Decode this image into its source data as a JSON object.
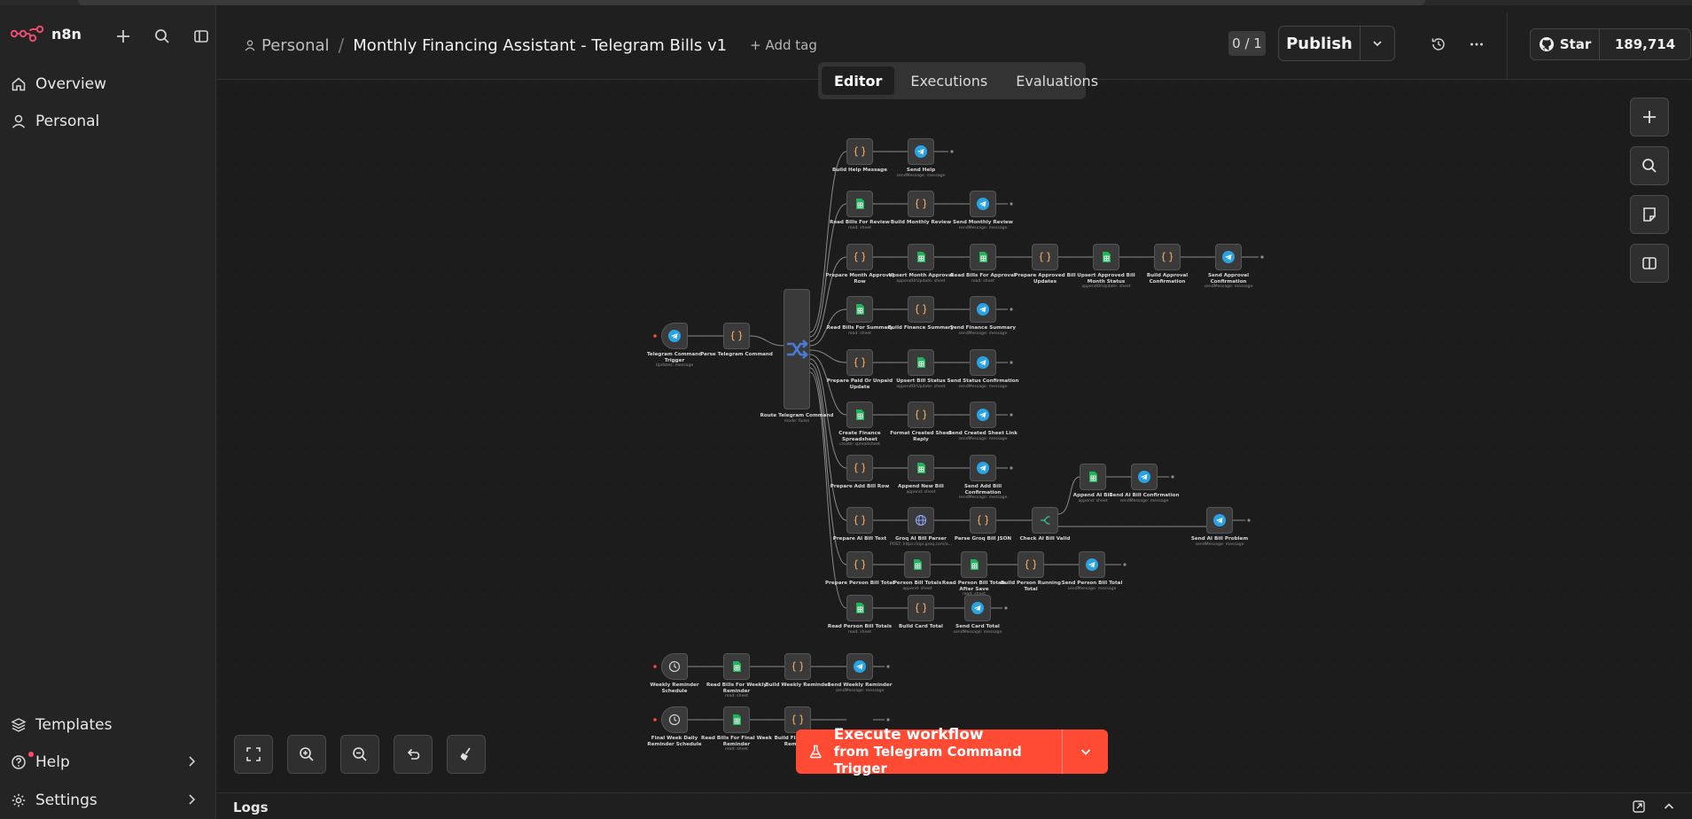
{
  "app": {
    "logo_text": "n8n"
  },
  "sidebar": {
    "top_items": [
      {
        "label": "Overview",
        "icon": "home-icon"
      },
      {
        "label": "Personal",
        "icon": "user-icon"
      }
    ],
    "bottom_items": [
      {
        "label": "Templates",
        "icon": "box-icon"
      },
      {
        "label": "Help",
        "icon": "help-icon"
      },
      {
        "label": "Settings",
        "icon": "gear-icon"
      }
    ]
  },
  "header": {
    "project": "Personal",
    "workflow_title": "Monthly Financing Assistant - Telegram Bills v1",
    "add_tag": "+ Add tag",
    "counter": "0 / 1",
    "publish": "Publish",
    "github_star": "Star",
    "github_count": "189,714"
  },
  "tabs": [
    {
      "label": "Editor",
      "active": true
    },
    {
      "label": "Executions",
      "active": false
    },
    {
      "label": "Evaluations",
      "active": false
    }
  ],
  "execute": {
    "title": "Execute workflow",
    "subtitle": "from Telegram Command Trigger"
  },
  "logs": {
    "label": "Logs"
  },
  "colors": {
    "accent": "#ff4a34",
    "telegram": "#2aa3e3",
    "sheets": "#22b35a",
    "code": "#e8a15b",
    "route": "#4b7bd8"
  },
  "nodes": {
    "trigger": {
      "label": "Telegram Command Trigger",
      "sub": "Updates: message"
    },
    "parse": {
      "label": "Parse Telegram Command",
      "sub": ""
    },
    "route": {
      "label": "Route Telegram Command",
      "sub": "mode: Rules"
    },
    "weekly_trigger": {
      "label": "Weekly Reminder Schedule",
      "sub": ""
    },
    "final_trigger": {
      "label": "Final Week Daily Reminder Schedule",
      "sub": ""
    },
    "rows": [
      [
        {
          "label": "Build Help Message",
          "sub": ""
        },
        {
          "label": "Send Help",
          "sub": "sendMessage: message"
        }
      ],
      [
        {
          "label": "Read Bills For Review",
          "sub": "read: sheet"
        },
        {
          "label": "Build Monthly Review",
          "sub": ""
        },
        {
          "label": "Send Monthly Review",
          "sub": "sendMessage: message"
        }
      ],
      [
        {
          "label": "Prepare Month Approval Row",
          "sub": ""
        },
        {
          "label": "Upsert Month Approval",
          "sub": "appendOrUpdate: sheet"
        },
        {
          "label": "Read Bills For Approval",
          "sub": "read: sheet"
        },
        {
          "label": "Prepare Approved Bill Updates",
          "sub": ""
        },
        {
          "label": "Upsert Approved Bill Month Status",
          "sub": "appendOrUpdate: sheet"
        },
        {
          "label": "Build Approval Confirmation",
          "sub": ""
        },
        {
          "label": "Send Approval Confirmation",
          "sub": "sendMessage: message"
        }
      ],
      [
        {
          "label": "Read Bills For Summary",
          "sub": "read: sheet"
        },
        {
          "label": "Build Finance Summary",
          "sub": ""
        },
        {
          "label": "Send Finance Summary",
          "sub": "sendMessage: message"
        }
      ],
      [
        {
          "label": "Prepare Paid Or Unpaid Update",
          "sub": ""
        },
        {
          "label": "Upsert Bill Status",
          "sub": "appendOrUpdate: sheet"
        },
        {
          "label": "Send Status Confirmation",
          "sub": "sendMessage: message"
        }
      ],
      [
        {
          "label": "Create Finance Spreadsheet",
          "sub": "create: spreadsheet"
        },
        {
          "label": "Format Created Sheet Reply",
          "sub": ""
        },
        {
          "label": "Send Created Sheet Link",
          "sub": "sendMessage: message"
        }
      ],
      [
        {
          "label": "Prepare Add Bill Row",
          "sub": ""
        },
        {
          "label": "Append New Bill",
          "sub": "append: sheet"
        },
        {
          "label": "Send Add Bill Confirmation",
          "sub": "sendMessage: message"
        }
      ],
      [
        {
          "label": "Prepare AI Bill Text",
          "sub": ""
        },
        {
          "label": "Groq AI Bill Parser",
          "sub": "POST: https://api.groq.com/o..."
        },
        {
          "label": "Parse Groq Bill JSON",
          "sub": ""
        },
        {
          "label": "Check AI Bill Valid",
          "sub": ""
        },
        {
          "label": "Send AI Bill Problem",
          "sub": "sendMessage: message"
        }
      ],
      [
        {
          "label": "Prepare Person Bill Total",
          "sub": ""
        },
        {
          "label": "Person Bill Totals",
          "sub": "append: sheet"
        },
        {
          "label": "Read Person Bill Totals After Save",
          "sub": "read: sheet"
        },
        {
          "label": "Build Person Running Total",
          "sub": ""
        },
        {
          "label": "Send Person Bill Total",
          "sub": "sendMessage: message"
        }
      ],
      [
        {
          "label": "Read Person Bill Totals",
          "sub": "read: sheet"
        },
        {
          "label": "Build Card Total",
          "sub": ""
        },
        {
          "label": "Send Card Total",
          "sub": "sendMessage: message"
        }
      ],
      [
        {
          "label": "Read Bills For Weekly Reminder",
          "sub": "read: sheet"
        },
        {
          "label": "Build Weekly Reminder",
          "sub": ""
        },
        {
          "label": "Send Weekly Reminder",
          "sub": "sendMessage: message"
        }
      ],
      [
        {
          "label": "Read Bills For Final Week Reminder",
          "sub": "read: sheet"
        },
        {
          "label": "Build Final Week Reminder",
          "sub": ""
        }
      ]
    ],
    "ai_valid_branch": [
      {
        "label": "Append AI Bill",
        "sub": "append: sheet"
      },
      {
        "label": "Send AI Bill Confirmation",
        "sub": "sendMessage: message"
      }
    ]
  }
}
